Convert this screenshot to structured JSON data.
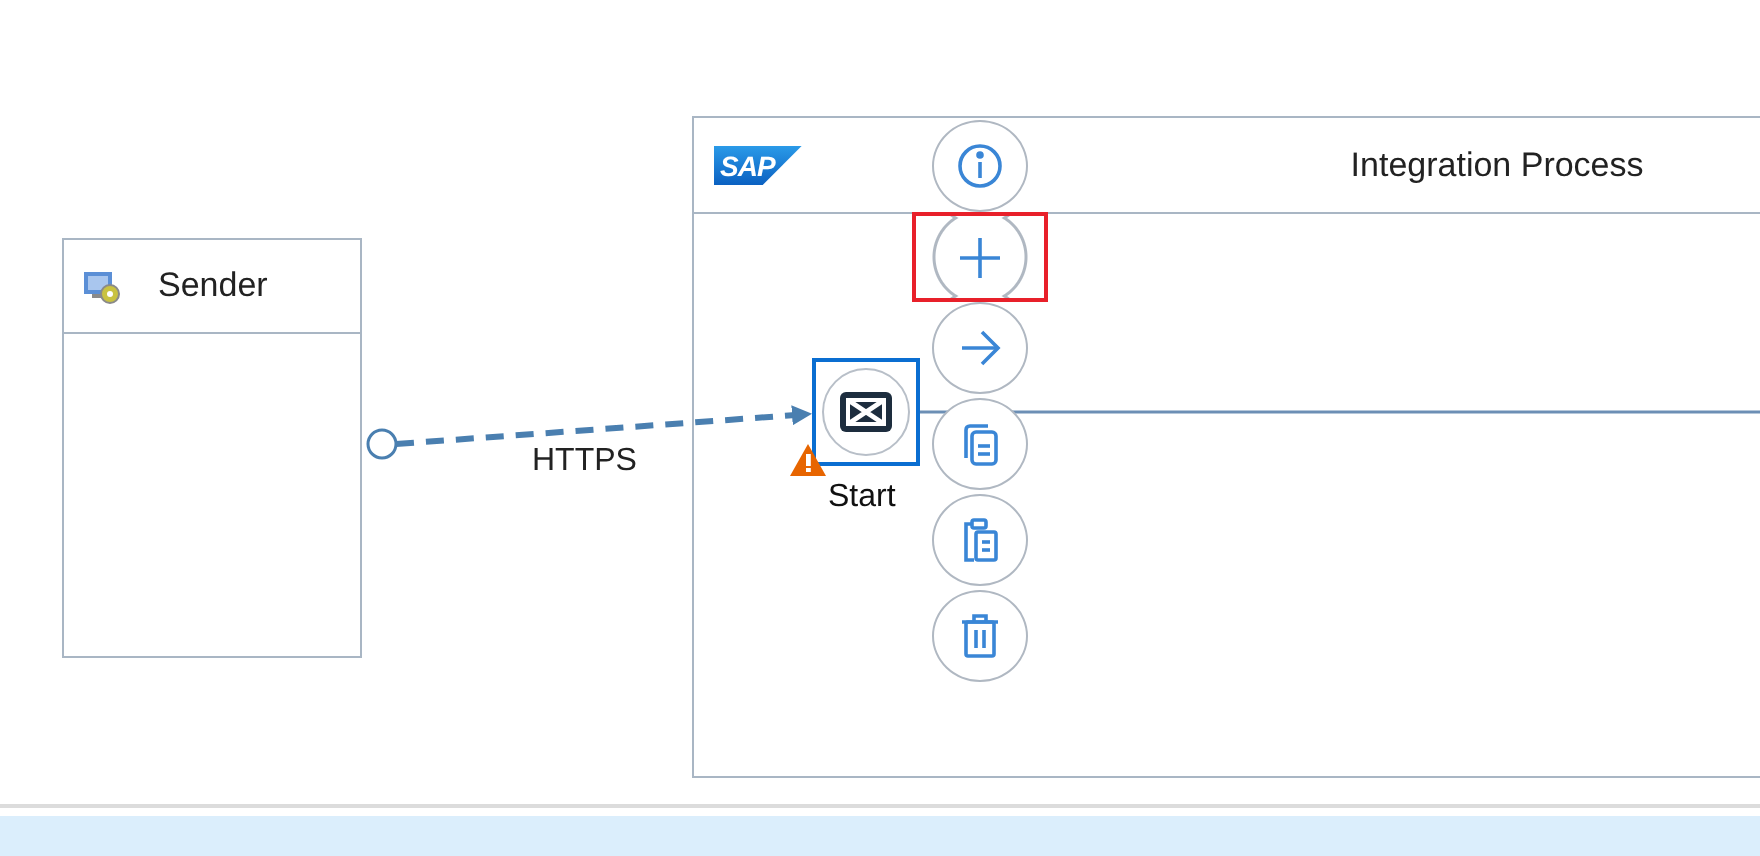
{
  "sender": {
    "title": "Sender"
  },
  "connection": {
    "label": "HTTPS"
  },
  "process": {
    "logo": "SAP",
    "title": "Integration Process"
  },
  "start_event": {
    "label": "Start",
    "selected": true,
    "warning": true
  },
  "context_menu": [
    {
      "kind": "info",
      "selected": false
    },
    {
      "kind": "add",
      "selected": true
    },
    {
      "kind": "connect",
      "selected": false
    },
    {
      "kind": "copy",
      "selected": false
    },
    {
      "kind": "paste",
      "selected": false
    },
    {
      "kind": "delete",
      "selected": false
    }
  ]
}
